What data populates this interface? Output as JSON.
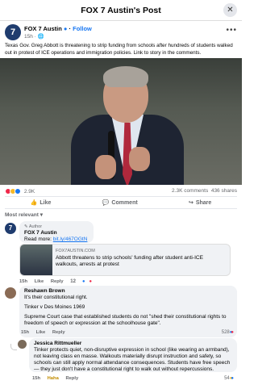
{
  "header": {
    "title": "FOX 7 Austin's Post",
    "close_icon": "close-icon"
  },
  "post": {
    "author": "FOX 7 Austin",
    "follow": "Follow",
    "time": "15h",
    "text": "Texas Gov. Greg Abbott is threatening to strip funding from schools after hundreds of students walked out in protest of ICE operations and immigration policies. Link to story in the comments.",
    "reactions_count": "2.9K",
    "comments_count": "2.3K comments",
    "shares_count": "436 shares",
    "reaction_colors": [
      "#f02849",
      "#f7b928",
      "#1877f2"
    ]
  },
  "actions": {
    "like": "Like",
    "comment": "Comment",
    "share": "Share"
  },
  "sort_label": "Most relevant",
  "comments": [
    {
      "author_tag": "Author",
      "author": "FOX 7 Austin",
      "text": "Read more:",
      "link": "bit.ly/467OGtN",
      "card": {
        "source": "FOX7AUSTIN.COM",
        "headline": "Abbott threatens to strip schools' funding after student anti-ICE walkouts, arrests at protest"
      },
      "time": "15h",
      "like": "Like",
      "reply": "Reply",
      "count": "12"
    },
    {
      "author": "Reshawn Brown",
      "line1": "It's their constitutional right.",
      "line2": "Tinker v Des Moines 1969",
      "line3": "Supreme Court case that established students do not \"shed their constitutional rights to freedom of speech or expression at the schoolhouse gate\".",
      "time": "15h",
      "like": "Like",
      "reply": "Reply",
      "count": "528"
    },
    {
      "author": "Jessica Rittmueller",
      "text": "Tinker protects quiet, non-disruptive expression in school (like wearing an armband), not leaving class en masse. Walkouts materially disrupt instruction and safety, so schools can still apply normal attendance consequences. Students have free speech — they just don't have a constitutional right to walk out without repercussions.",
      "time": "15h",
      "haha": "Haha",
      "reply": "Reply",
      "count": "54"
    }
  ]
}
